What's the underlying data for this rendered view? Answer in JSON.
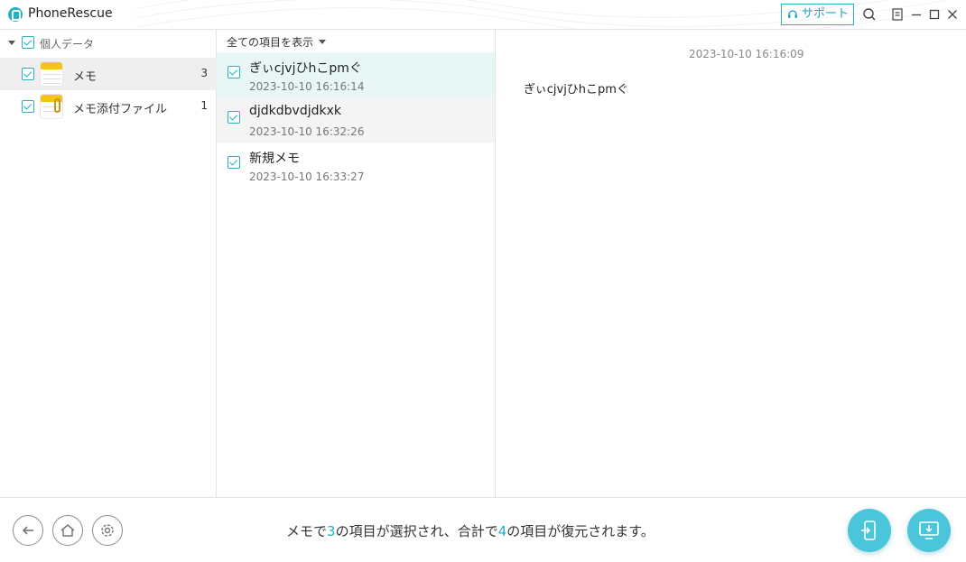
{
  "app": {
    "title": "PhoneRescue",
    "support_label": "サポート"
  },
  "sidebar": {
    "group_label": "個人データ",
    "items": [
      {
        "label": "メモ",
        "count": "3"
      },
      {
        "label": "メモ添付ファイル",
        "count": "1"
      }
    ]
  },
  "list": {
    "filter_label": "全ての項目を表示",
    "rows": [
      {
        "title": "ぎぃcjvjひhこpmぐ",
        "date": "2023-10-10 16:16:14"
      },
      {
        "title": "djdkdbvdjdkxk",
        "date": "2023-10-10 16:32:26"
      },
      {
        "title": "新規メモ",
        "date": "2023-10-10 16:33:27"
      }
    ]
  },
  "detail": {
    "date": "2023-10-10 16:16:09",
    "text": "ぎぃcjvjひhこpmぐ"
  },
  "footer": {
    "status_prefix": "メモで",
    "selected_count": "3",
    "status_middle": "の項目が選択され、合計で",
    "total_count": "4",
    "status_suffix": "の項目が復元されます。"
  },
  "colors": {
    "accent": "#29b0c1",
    "selected_row": "#e8f7f6"
  }
}
